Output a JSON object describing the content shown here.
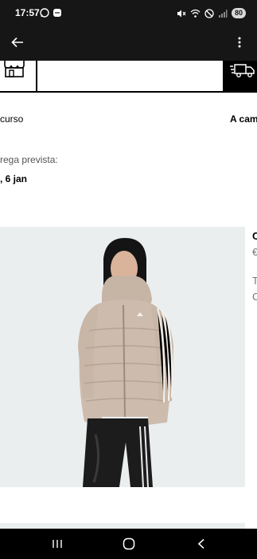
{
  "status_bar": {
    "time": "17:57",
    "battery": "80"
  },
  "tracker": {
    "step_left_label": "curso",
    "step_right_label": "A cami"
  },
  "delivery": {
    "label": "rega prevista:",
    "date": ", 6 jan"
  },
  "product": {
    "name_fragment": "C",
    "price_fragment": "€",
    "info_line1": "T",
    "info_line2": "C",
    "image_alt": "Puffer jacket"
  },
  "colors": {
    "status_bar": "#161616",
    "image_bg": "#eaeeef",
    "jacket": "#cdbcad"
  }
}
